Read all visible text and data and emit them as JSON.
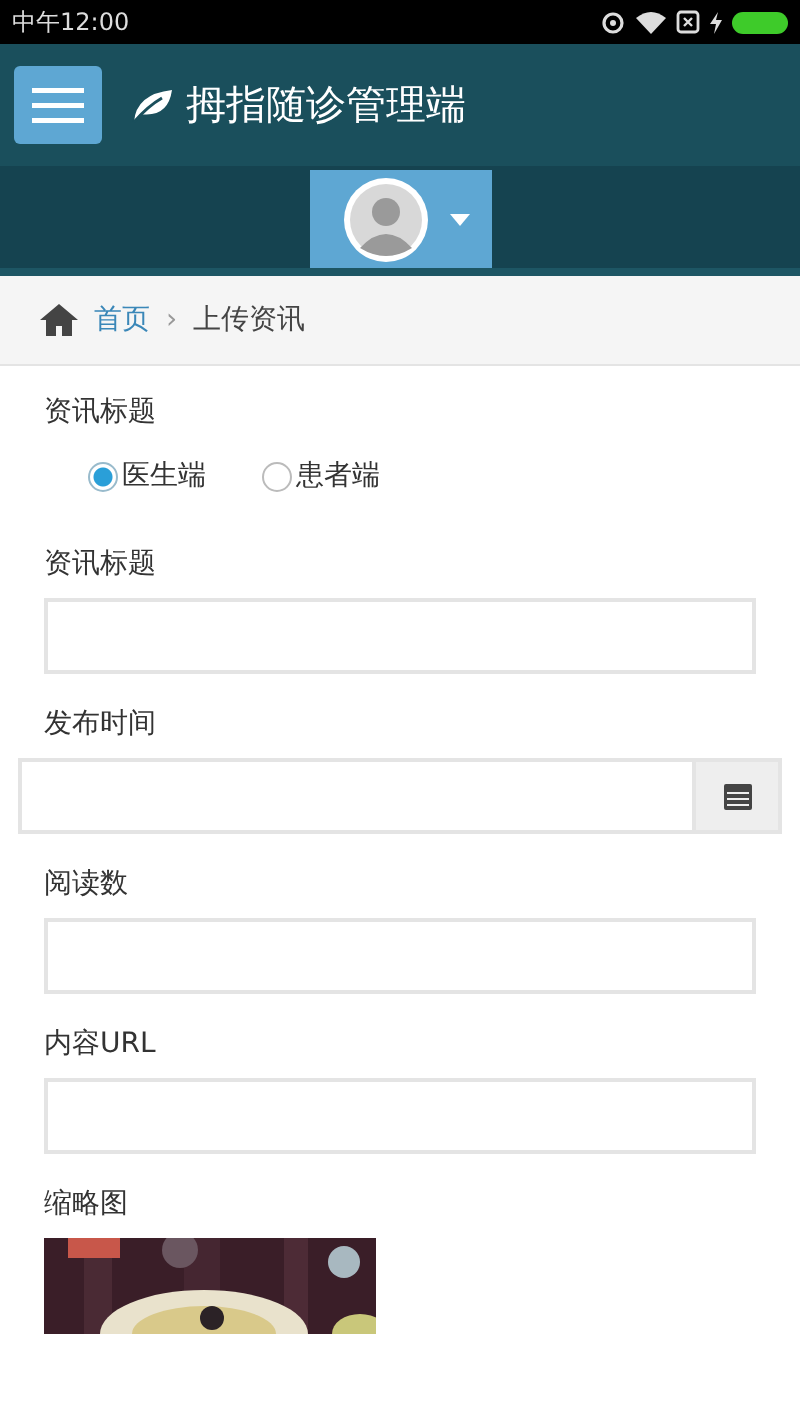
{
  "status_bar": {
    "time": "中午12:00"
  },
  "header": {
    "title": "拇指随诊管理端"
  },
  "breadcrumb": {
    "home": "首页",
    "separator": "›",
    "current": "上传资讯"
  },
  "form": {
    "fields": [
      {
        "kind": "radio",
        "label": "资讯标题",
        "options": [
          {
            "label": "医生端",
            "selected": true
          },
          {
            "label": "患者端",
            "selected": false
          }
        ]
      },
      {
        "kind": "text",
        "label": "资讯标题"
      },
      {
        "kind": "date",
        "label": "发布时间"
      },
      {
        "kind": "text",
        "label": "阅读数"
      },
      {
        "kind": "text",
        "label": "内容URL"
      },
      {
        "kind": "picture",
        "label": "缩略图"
      }
    ]
  }
}
